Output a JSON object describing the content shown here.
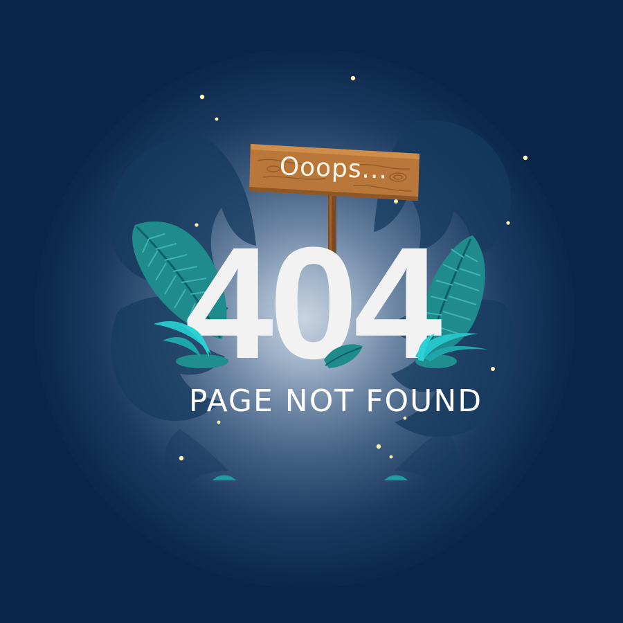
{
  "sign": {
    "text": "Ooops..."
  },
  "error": {
    "code": "404",
    "message": "PAGE NOT FOUND"
  },
  "colors": {
    "background": "#0a2548",
    "glow": "#c9d4e0",
    "sign_wood": "#b9783a",
    "leaf": "#1c8e90",
    "leaf_bright": "#26c4c9",
    "star": "#fff5b0",
    "text": "#f2f2f2"
  },
  "icons": [
    "monstera-leaf-icon",
    "tropical-leaf-icon",
    "grass-tuft-icon",
    "wooden-sign-icon",
    "star-icon"
  ]
}
